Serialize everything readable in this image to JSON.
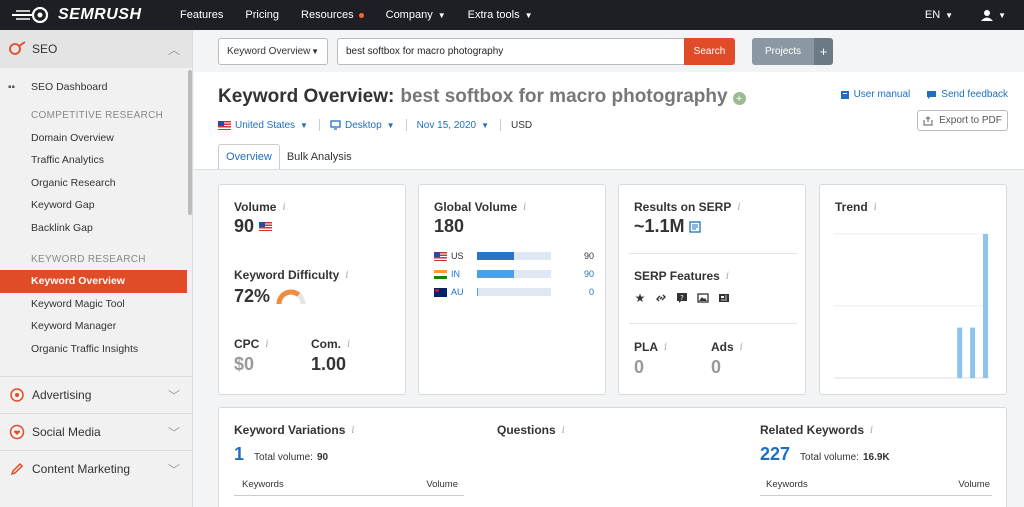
{
  "brand": {
    "logo_text": "SEMRUSH",
    "accent": "#e04c27",
    "topbar_bg": "#1d1f24"
  },
  "topnav": {
    "items": [
      {
        "label": "Features"
      },
      {
        "label": "Pricing"
      },
      {
        "label": "Resources"
      },
      {
        "label": "Company"
      },
      {
        "label": "Extra tools"
      }
    ],
    "lang": "EN"
  },
  "sidebar": {
    "seo_label": "SEO",
    "dashboard": "SEO Dashboard",
    "competitive_heading": "COMPETITIVE RESEARCH",
    "competitive_items": [
      "Domain Overview",
      "Traffic Analytics",
      "Organic Research",
      "Keyword Gap",
      "Backlink Gap"
    ],
    "keyword_heading": "KEYWORD RESEARCH",
    "keyword_items": [
      "Keyword Overview",
      "Keyword Magic Tool",
      "Keyword Manager",
      "Organic Traffic Insights"
    ],
    "advertising": "Advertising",
    "social": "Social Media",
    "content": "Content Marketing"
  },
  "search": {
    "db_label": "Keyword Overview",
    "query": "best softbox for macro photography",
    "button": "Search",
    "projects": "Projects",
    "plus": "+"
  },
  "header": {
    "title": "Keyword Overview:",
    "keyword": "best softbox for macro photography",
    "country": "United States",
    "device": "Desktop",
    "date": "Nov 15, 2020",
    "currency": "USD",
    "user_manual": "User manual",
    "send_feedback": "Send feedback",
    "export": "Export to PDF"
  },
  "tabs": [
    "Overview",
    "Bulk Analysis"
  ],
  "volume": {
    "label": "Volume",
    "value": "90"
  },
  "difficulty": {
    "label": "Keyword Difficulty",
    "value": "72%",
    "percent": 72,
    "color": "#f08c3c"
  },
  "cpc": {
    "label": "CPC",
    "value": "$0"
  },
  "com": {
    "label": "Com.",
    "value": "1.00"
  },
  "global": {
    "label": "Global Volume",
    "value": "180",
    "rows": [
      {
        "country": "US",
        "value": "90",
        "fill": 0.5,
        "color": "#2a74c6"
      },
      {
        "country": "IN",
        "value": "90",
        "fill": 0.5,
        "color": "#4ea0e6"
      },
      {
        "country": "AU",
        "value": "0",
        "fill": 0.02,
        "color": "#4ea0e6"
      }
    ]
  },
  "serp": {
    "label": "Results on SERP",
    "value": "~1.1M",
    "features_label": "SERP Features",
    "pla_label": "PLA",
    "pla_value": "0",
    "ads_label": "Ads",
    "ads_value": "0"
  },
  "trend": {
    "label": "Trend",
    "values": [
      0,
      0,
      0,
      0,
      0,
      0,
      0,
      0,
      0,
      0.35,
      0.35,
      1.0
    ]
  },
  "variations": {
    "label": "Keyword Variations",
    "count": "1",
    "total_label": "Total volume:",
    "total": "90",
    "col1": "Keywords",
    "col2": "Volume"
  },
  "questions": {
    "label": "Questions"
  },
  "related": {
    "label": "Related Keywords",
    "count": "227",
    "total_label": "Total volume:",
    "total": "16.9K",
    "col1": "Keywords",
    "col2": "Volume"
  }
}
